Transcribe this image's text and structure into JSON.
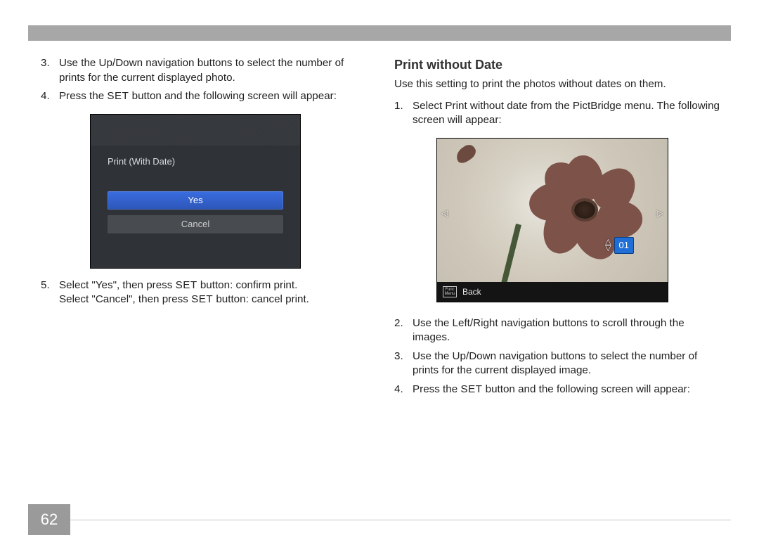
{
  "page_number": "62",
  "left": {
    "items": [
      {
        "n": "3.",
        "text": "Use the Up/Down navigation buttons to select the number of prints for the current displayed photo."
      },
      {
        "n": "4.",
        "pre": "Press the ",
        "set": "SET",
        "post": " button and the following screen will appear:"
      },
      {
        "n": "5.",
        "line1_pre": "Select \"Yes\", then press ",
        "line1_set": "SET",
        "line1_post": " button: confirm print.",
        "line2_pre": "Select \"Cancel\", then press ",
        "line2_set": "SET",
        "line2_post": " button: cancel print."
      }
    ],
    "screen": {
      "title": "Print (With Date)",
      "option_yes": "Yes",
      "option_cancel": "Cancel"
    }
  },
  "right": {
    "heading": "Print without Date",
    "intro": "Use this setting to print the photos without dates on them.",
    "items": [
      {
        "n": "1.",
        "text": "Select Print without date from the PictBridge menu. The following screen will appear:"
      },
      {
        "n": "2.",
        "text": "Use the Left/Right navigation buttons to scroll through the images."
      },
      {
        "n": "3.",
        "text": "Use the Up/Down navigation buttons to select the number of prints for the current displayed image."
      },
      {
        "n": "4.",
        "pre": "Press the ",
        "set": "SET",
        "post": " button and the following screen will appear:"
      }
    ],
    "screen": {
      "count": "01",
      "back_label": "Back",
      "func_top": "Func",
      "func_bot": "Menu"
    }
  }
}
